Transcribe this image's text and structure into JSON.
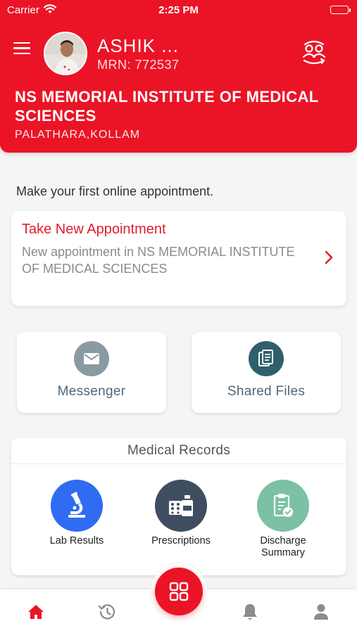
{
  "status_bar": {
    "carrier": "Carrier",
    "time": "2:25 PM"
  },
  "header": {
    "user_name": "ASHIK ...",
    "mrn": "MRN: 772537",
    "hospital_name": "NS MEMORIAL INSTITUTE OF MEDICAL SCIENCES",
    "hospital_location": "PALATHARA,KOLLAM",
    "icons": {
      "menu": "menu-icon",
      "switch_user": "switch-user-icon"
    }
  },
  "intro_text": "Make your first online appointment.",
  "appointment_card": {
    "title": "Take New Appointment",
    "subtitle": "New appointment in NS MEMORIAL INSTITUTE OF MEDICAL SCIENCES"
  },
  "tiles": {
    "messenger": {
      "label": "Messenger",
      "icon": "envelope-icon",
      "color": "#8a9aa2"
    },
    "shared_files": {
      "label": "Shared Files",
      "icon": "document-icon",
      "color": "#2e5f6b"
    }
  },
  "medical_records": {
    "title": "Medical Records",
    "items": [
      {
        "label": "Lab Results",
        "icon": "microscope-icon",
        "color": "#2f6cf1"
      },
      {
        "label": "Prescriptions",
        "icon": "medicine-icon",
        "color": "#3f4d60"
      },
      {
        "label": "Discharge Summary",
        "icon": "clipboard-check-icon",
        "color": "#7cc1a4"
      }
    ]
  },
  "tab_bar": {
    "tabs": [
      "home-icon",
      "history-icon",
      "grid-icon",
      "bell-icon",
      "profile-icon"
    ],
    "active_tab": "home-icon",
    "accent_color": "#eb1426"
  }
}
